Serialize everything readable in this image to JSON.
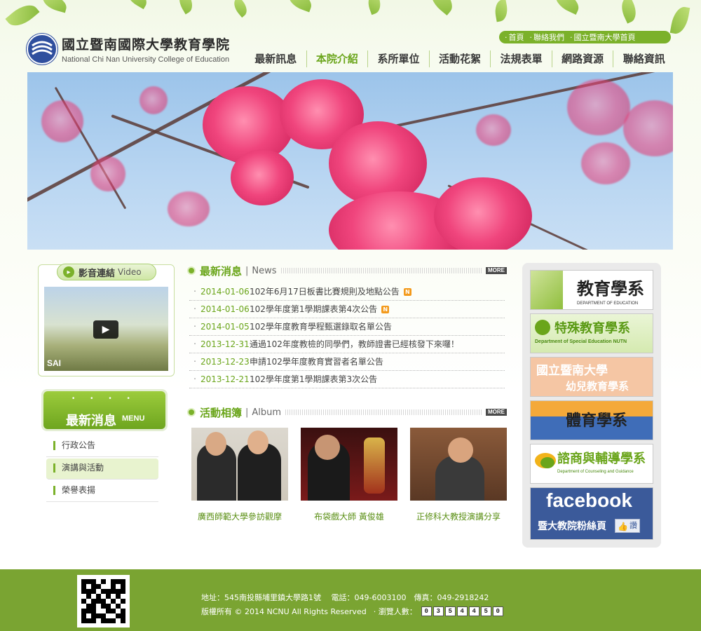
{
  "brand": {
    "name_zh": "國立暨南國際大學教育學院",
    "name_en": "National Chi Nan University College of Education",
    "accent_color": "#7bb12a"
  },
  "top_links": [
    "首頁",
    "聯絡我們",
    "國立暨南大學首頁"
  ],
  "nav": {
    "items": [
      "最新訊息",
      "本院介紹",
      "系所單位",
      "活動花絮",
      "法規表單",
      "網路資源",
      "聯絡資訊"
    ],
    "active": "本院介紹"
  },
  "video": {
    "title_zh": "影音連結",
    "title_en": "Video",
    "thumb_label": "SAI",
    "play_icon": "play-icon"
  },
  "menu": {
    "title_zh": "最新消息",
    "title_en": "MENU",
    "dots": "• • • •",
    "items": [
      "行政公告",
      "演講與活動",
      "榮譽表揚"
    ],
    "active": "演講與活動"
  },
  "news": {
    "title_zh": "最新消息",
    "title_en": "News",
    "sep": "|",
    "more": "MORE",
    "items": [
      {
        "date": "2014-01-06",
        "title": "102年6月17日板書比賽規則及地點公告",
        "badge": "N"
      },
      {
        "date": "2014-01-06",
        "title": "102學年度第1學期課表第4次公告",
        "badge": "N"
      },
      {
        "date": "2014-01-05",
        "title": "102學年度教育學程甄選錄取名單公告",
        "badge": ""
      },
      {
        "date": "2013-12-31",
        "title": "通過102年度教檢的同學們，教師證書已經核發下來囉！",
        "badge": ""
      },
      {
        "date": "2013-12-23",
        "title": "申請102學年度教育實習者名單公告",
        "badge": ""
      },
      {
        "date": "2013-12-21",
        "title": "102學年度第1學期課表第3次公告",
        "badge": ""
      }
    ]
  },
  "album": {
    "title_zh": "活動相簿",
    "title_en": "Album",
    "sep": "|",
    "more": "MORE",
    "items": [
      {
        "caption": "廣西師範大學參訪觀摩"
      },
      {
        "caption": "布袋戲大師 黃俊雄"
      },
      {
        "caption": "正修科大教授演講分享"
      }
    ]
  },
  "departments": [
    {
      "name": "教育學系",
      "sub": "DEPARTMENT OF EDUCATION"
    },
    {
      "name": "特殊教育學系",
      "sub": "Department of Special Education NUTN"
    },
    {
      "name": "國立暨南大學",
      "sub": "幼兒教育學系"
    },
    {
      "name": "體育學系",
      "sub": ""
    },
    {
      "name": "諮商與輔導學系",
      "sub": "Department of Counseling and Guidance"
    },
    {
      "name": "facebook",
      "sub": "暨大教院粉絲頁",
      "like": "讚"
    }
  ],
  "footer": {
    "line1": "地址：545南投縣埔里鎮大學路1號　 電話：049-6003100　傳真：049-2918242",
    "copyright": "版權所有 © 2014 NCNU All Rights Reserved",
    "visitors_label": "‧ 瀏覽人數：",
    "visitor_digits": [
      "0",
      "3",
      "5",
      "4",
      "4",
      "5",
      "0"
    ]
  }
}
